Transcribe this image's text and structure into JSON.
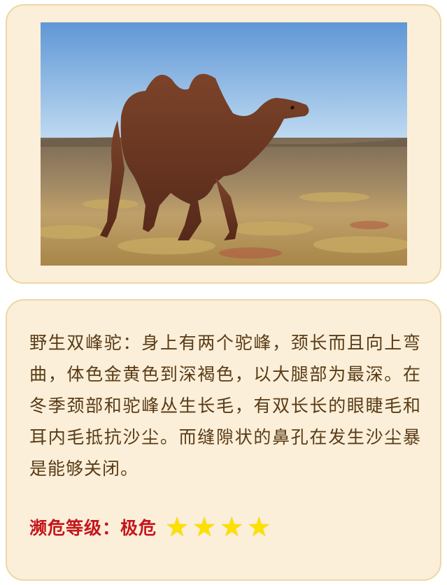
{
  "photo": {
    "subject": "bactrian-camel",
    "colors": {
      "sky_top": "#5f97d6",
      "sky_bottom": "#c2dcf2",
      "ground": "#a08864",
      "grass": "#c3a463",
      "camel": "#6a3622"
    }
  },
  "info": {
    "description": "野生双峰驼：身上有两个驼峰，颈长而且向上弯曲，体色金黄色到深褐色，以大腿部为最深。在冬季颈部和驼峰丛生长毛，有双长长的眼睫毛和耳内毛抵抗沙尘。而缝隙状的鼻孔在发生沙尘暴是能够关闭。",
    "status_label": "濒危等级：",
    "status_value": "极危",
    "star_count": 4,
    "star_glyph": "★"
  },
  "colors": {
    "card_bg": "#fbefd9",
    "card_border": "#ecd7a6",
    "text": "#5a3b16",
    "accent_red": "#c4161c",
    "star": "#fde000"
  }
}
